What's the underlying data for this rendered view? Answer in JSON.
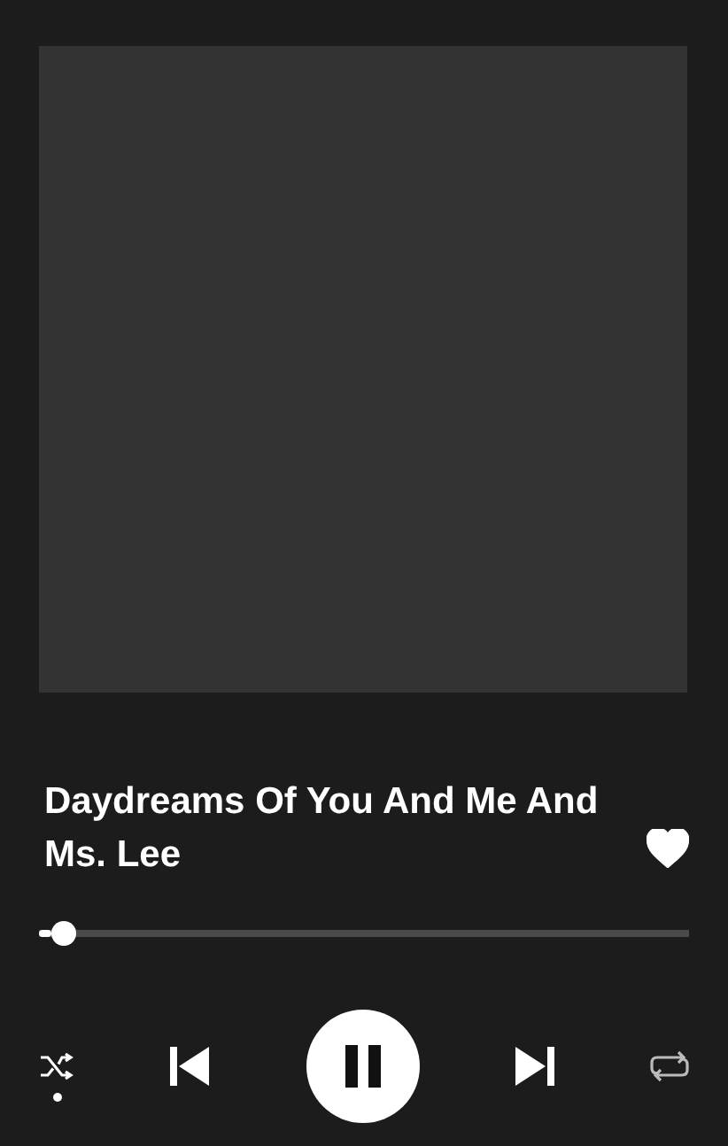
{
  "track": {
    "title": "Daydreams Of You And Me And Ms. Lee",
    "liked": true
  },
  "progress": {
    "level": 0.02
  },
  "controls": {
    "shuffle": true,
    "playing": true,
    "repeat": false
  }
}
